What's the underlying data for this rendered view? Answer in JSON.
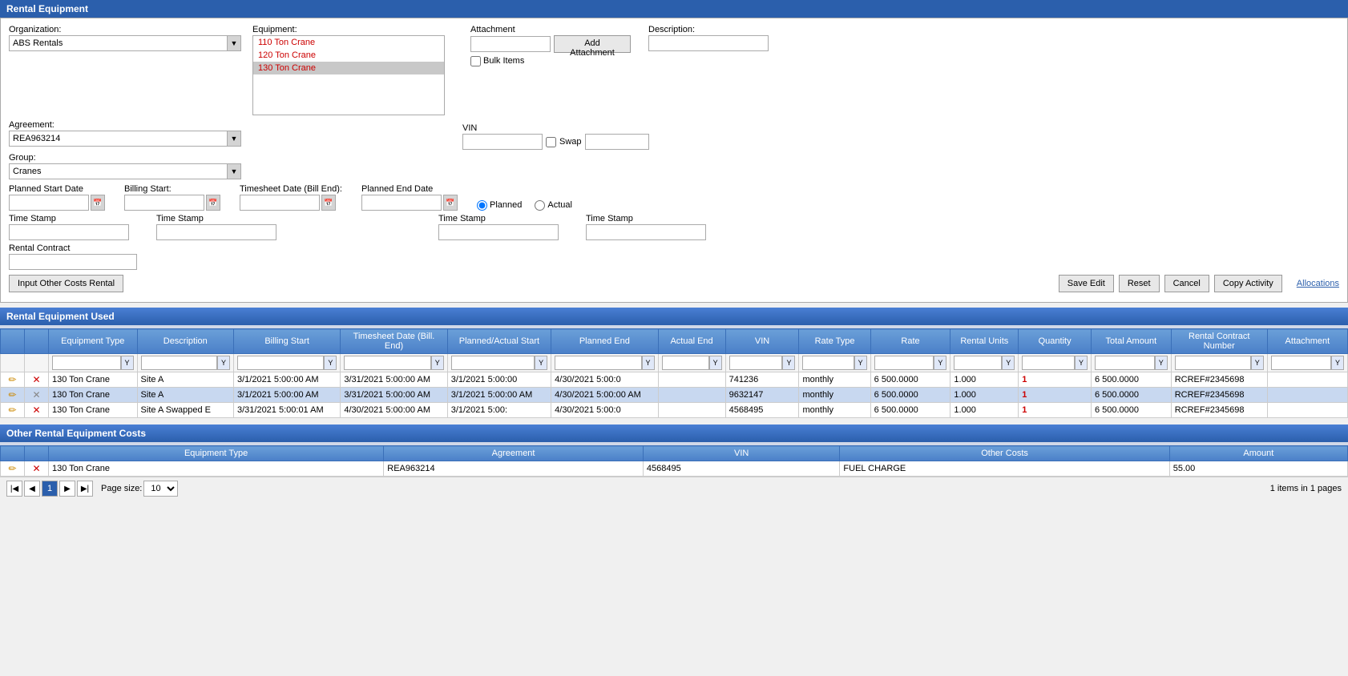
{
  "page": {
    "title": "Rental Equipment"
  },
  "form": {
    "organization_label": "Organization:",
    "organization_value": "ABS Rentals",
    "equipment_label": "Equipment:",
    "agreement_label": "Agreement:",
    "agreement_value": "REA963214",
    "group_label": "Group:",
    "group_value": "Cranes",
    "attachment_label": "Attachment",
    "add_attachment_btn": "Add Attachment",
    "bulk_items_label": "Bulk Items",
    "description_label": "Description:",
    "vin_label": "VIN",
    "swap_label": "Swap",
    "planned_start_label": "Planned Start Date",
    "billing_start_label": "Billing Start:",
    "timesheet_date_label": "Timesheet Date (Bill End):",
    "planned_end_label": "Planned End Date",
    "planned_radio": "Planned",
    "actual_radio": "Actual",
    "time_stamp_label": "Time Stamp",
    "rental_contract_label": "Rental Contract",
    "input_other_costs_btn": "Input Other Costs Rental",
    "save_edit_btn": "Save Edit",
    "reset_btn": "Reset",
    "cancel_btn": "Cancel",
    "copy_activity_btn": "Copy Activity",
    "allocations_link": "Allocations",
    "equipment_list": [
      {
        "name": "110 Ton Crane",
        "selected": false
      },
      {
        "name": "120 Ton Crane",
        "selected": false
      },
      {
        "name": "130 Ton Crane",
        "selected": true
      }
    ]
  },
  "rental_equipment_used": {
    "section_title": "Rental Equipment Used",
    "columns": [
      "Equipment Type",
      "Description",
      "Billing Start",
      "Timesheet Date (Bill. End)",
      "Planned/Actual Start",
      "Planned End",
      "Actual End",
      "VIN",
      "Rate Type",
      "Rate",
      "Rental Units",
      "Quantity",
      "Total Amount",
      "Rental Contract Number",
      "Attachment"
    ],
    "rows": [
      {
        "equipment_type": "130 Ton Crane",
        "description": "Site A",
        "billing_start": "3/1/2021 5:00:00 AM",
        "timesheet_date": "3/31/2021 5:00:00 AM",
        "planned_actual_start": "3/1/2021 5:00:00",
        "planned_end": "4/30/2021 5:00:0",
        "actual_end": "",
        "vin": "741236",
        "rate_type": "monthly",
        "rate": "6 500.0000",
        "rental_units": "1.000",
        "quantity": "1",
        "total_amount": "6 500.0000",
        "rental_contract": "RCREF#2345698",
        "attachment": "",
        "highlighted": false,
        "delete_active": true
      },
      {
        "equipment_type": "130 Ton Crane",
        "description": "Site A",
        "billing_start": "3/1/2021 5:00:00 AM",
        "timesheet_date": "3/31/2021 5:00:00 AM",
        "planned_actual_start": "3/1/2021 5:00:00 AM",
        "planned_end": "4/30/2021 5:00:00 AM",
        "actual_end": "",
        "vin": "9632147",
        "rate_type": "monthly",
        "rate": "6 500.0000",
        "rental_units": "1.000",
        "quantity": "1",
        "total_amount": "6 500.0000",
        "rental_contract": "RCREF#2345698",
        "attachment": "",
        "highlighted": true,
        "delete_active": false
      },
      {
        "equipment_type": "130 Ton Crane",
        "description": "Site A Swapped E",
        "billing_start": "3/31/2021 5:00:01 AM",
        "timesheet_date": "4/30/2021 5:00:00 AM",
        "planned_actual_start": "3/1/2021 5:00:",
        "planned_end": "4/30/2021 5:00:0",
        "actual_end": "",
        "vin": "4568495",
        "rate_type": "monthly",
        "rate": "6 500.0000",
        "rental_units": "1.000",
        "quantity": "1",
        "total_amount": "6 500.0000",
        "rental_contract": "RCREF#2345698",
        "attachment": "",
        "highlighted": false,
        "delete_active": true
      }
    ]
  },
  "other_costs": {
    "section_title": "Other Rental Equipment Costs",
    "columns": [
      "Equipment Type",
      "Agreement",
      "VIN",
      "Other Costs",
      "Amount"
    ],
    "rows": [
      {
        "equipment_type": "130 Ton Crane",
        "agreement": "REA963214",
        "vin": "4568495",
        "other_costs": "FUEL CHARGE",
        "amount": "55.00",
        "delete_active": true
      }
    ]
  },
  "pagination": {
    "page_size_label": "Page size:",
    "page_size": "10",
    "current_page": "1",
    "items_info": "1 items in 1 pages"
  }
}
